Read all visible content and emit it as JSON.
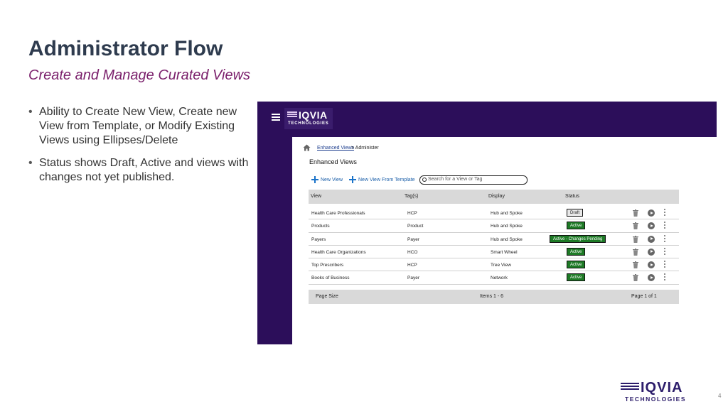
{
  "slide": {
    "title": "Administrator Flow",
    "subtitle": "Create and Manage Curated Views",
    "bullets": [
      "Ability to Create New View, Create new View from Template, or Modify Existing Views using Ellipses/Delete",
      "Status shows Draft, Active and views with changes not yet published."
    ],
    "page_number": "4"
  },
  "brand": {
    "word": "IQVIA",
    "sub": "TECHNOLOGIES"
  },
  "app": {
    "logo_word": "IQVIA",
    "logo_sub": "TECHNOLOGIES",
    "breadcrumb": {
      "link": "Enhanced Views",
      "current": "> Administer"
    },
    "page_title": "Enhanced Views",
    "toolbar": {
      "new_view": "New View",
      "new_from_template": "New View From Template",
      "search_placeholder": "Search for a View or Tag"
    },
    "table": {
      "columns": [
        "View",
        "Tag(s)",
        "Display",
        "Status"
      ],
      "rows": [
        {
          "view": "Health Care Professionals",
          "tags": "HCP",
          "display": "Hub and Spoke",
          "status": "Draft"
        },
        {
          "view": "Products",
          "tags": "Product",
          "display": "Hub and Spoke",
          "status": "Active"
        },
        {
          "view": "Payers",
          "tags": "Payer",
          "display": "Hub and Spoke",
          "status": "Active - Changes Pending"
        },
        {
          "view": "Health Care Organizations",
          "tags": "HCO",
          "display": "Smart Wheel",
          "status": "Active"
        },
        {
          "view": "Top Prescribers",
          "tags": "HCP",
          "display": "Tree View",
          "status": "Active"
        },
        {
          "view": "Books of Business",
          "tags": "Payer",
          "display": "Network",
          "status": "Active"
        }
      ],
      "footer": {
        "page_size": "Page Size",
        "items": "Items 1 - 6",
        "page": "Page  1 of  1"
      }
    },
    "colors": {
      "nav": "#2c0e5a",
      "active": "#1e7a26",
      "draft": "#e8e8e8"
    }
  }
}
